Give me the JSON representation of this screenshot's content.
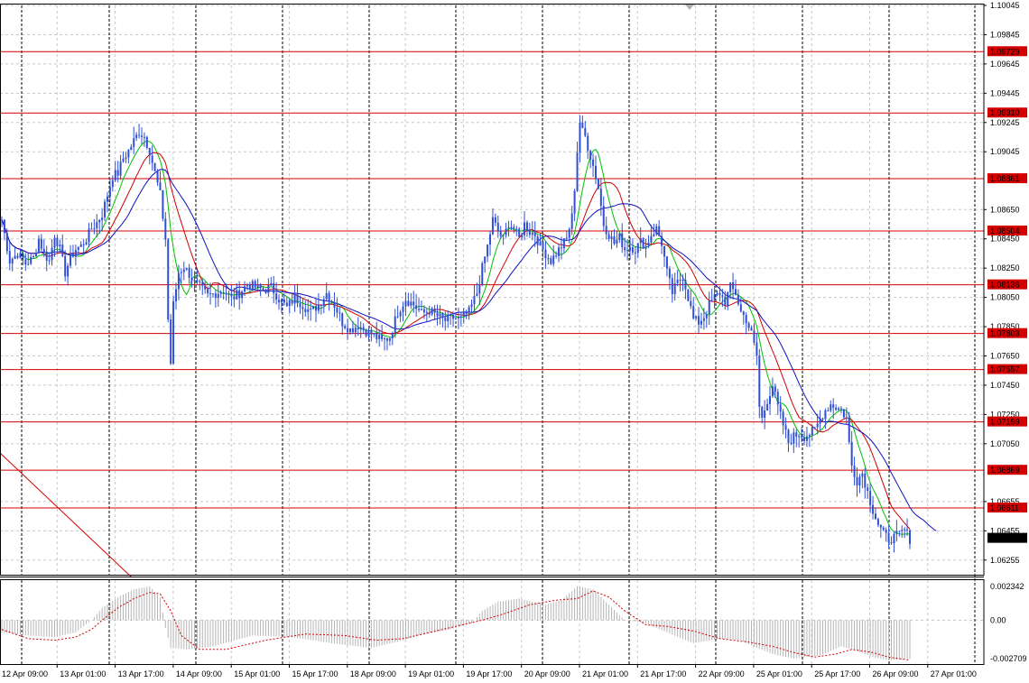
{
  "colors": {
    "background": "#ffffff",
    "grid": "#c8c8c8",
    "candle": "#2f4fd6",
    "level_line": "#d40000",
    "level_badge_bg": "#d40000",
    "level_badge_text": "#ffffff",
    "last_price_bg": "#000000",
    "last_price_text": "#ffffff",
    "ma_fast": "#00c000",
    "ma_mid": "#d00000",
    "ma_slow": "#1010c0",
    "histogram": "#b4b4b4",
    "signal": "#d00000"
  },
  "chart_data": [
    {
      "type": "candlestick",
      "title": "",
      "price_axis": {
        "ylim": [
          1.06155,
          1.10045
        ],
        "tick_labels": [
          "1.10045",
          "1.09845",
          "1.09645",
          "1.09445",
          "1.09245",
          "1.09045",
          "1.08650",
          "1.08450",
          "1.08250",
          "1.08050",
          "1.07850",
          "1.07650",
          "1.07450",
          "1.07250",
          "1.07050",
          "1.06655",
          "1.06455",
          "1.06255"
        ]
      },
      "time_axis": {
        "tick_labels": [
          "12 Apr 09:00",
          "13 Apr 01:00",
          "13 Apr 17:00",
          "14 Apr 09:00",
          "15 Apr 01:00",
          "15 Apr 17:00",
          "18 Apr 09:00",
          "19 Apr 01:00",
          "19 Apr 17:00",
          "20 Apr 09:00",
          "21 Apr 01:00",
          "21 Apr 17:00",
          "22 Apr 09:00",
          "25 Apr 01:00",
          "25 Apr 17:00",
          "26 Apr 09:00",
          "27 Apr 01:00"
        ],
        "period_separators": [
          "13 Apr 01:00",
          "14 Apr 01:00",
          "15 Apr 01:00",
          "18 Apr 01:00",
          "19 Apr 01:00",
          "20 Apr 01:00",
          "21 Apr 01:00",
          "22 Apr 01:00",
          "25 Apr 01:00",
          "26 Apr 01:00",
          "27 Apr 01:00"
        ]
      },
      "horizontal_levels": [
        "1.09729",
        "1.09310",
        "1.08861",
        "1.08504",
        "1.08136",
        "1.07803",
        "1.07557",
        "1.07199",
        "1.06869",
        "1.06611"
      ],
      "last_price": "1.06404",
      "close_path": [
        [
          0,
          1.0858
        ],
        [
          3,
          1.083
        ],
        [
          6,
          1.0835
        ],
        [
          9,
          1.0828
        ],
        [
          12,
          1.0832
        ],
        [
          14,
          1.0845
        ],
        [
          16,
          1.0835
        ],
        [
          18,
          1.083
        ],
        [
          20,
          1.0848
        ],
        [
          22,
          1.0838
        ],
        [
          24,
          1.0822
        ],
        [
          26,
          1.0832
        ],
        [
          28,
          1.0838
        ],
        [
          30,
          1.084
        ],
        [
          32,
          1.0845
        ],
        [
          34,
          1.0852
        ],
        [
          36,
          1.0856
        ],
        [
          38,
          1.0862
        ],
        [
          40,
          1.0875
        ],
        [
          42,
          1.0888
        ],
        [
          44,
          1.089
        ],
        [
          46,
          1.09
        ],
        [
          48,
          1.0905
        ],
        [
          50,
          1.0912
        ],
        [
          52,
          1.0918
        ],
        [
          54,
          1.0915
        ],
        [
          56,
          1.0905
        ],
        [
          58,
          1.089
        ],
        [
          60,
          1.0875
        ],
        [
          62,
          1.0845
        ],
        [
          63,
          1.079
        ],
        [
          64,
          1.076
        ],
        [
          65,
          1.08
        ],
        [
          67,
          1.0822
        ],
        [
          69,
          1.0826
        ],
        [
          71,
          1.0821
        ],
        [
          73,
          1.0815
        ],
        [
          75,
          1.0812
        ],
        [
          78,
          1.0806
        ],
        [
          81,
          1.0808
        ],
        [
          84,
          1.081
        ],
        [
          87,
          1.0804
        ],
        [
          90,
          1.0808
        ],
        [
          93,
          1.0814
        ],
        [
          96,
          1.0812
        ],
        [
          99,
          1.081
        ],
        [
          102,
          1.0812
        ],
        [
          105,
          1.0804
        ],
        [
          108,
          1.0798
        ],
        [
          111,
          1.0805
        ],
        [
          114,
          1.08
        ],
        [
          117,
          1.0795
        ],
        [
          120,
          1.08
        ],
        [
          123,
          1.0808
        ],
        [
          126,
          1.08
        ],
        [
          129,
          1.0788
        ],
        [
          132,
          1.0783
        ],
        [
          135,
          1.0786
        ],
        [
          138,
          1.0782
        ],
        [
          141,
          1.0779
        ],
        [
          144,
          1.0775
        ],
        [
          147,
          1.0778
        ],
        [
          150,
          1.0795
        ],
        [
          153,
          1.0804
        ],
        [
          156,
          1.08
        ],
        [
          159,
          1.0794
        ],
        [
          162,
          1.0796
        ],
        [
          165,
          1.0792
        ],
        [
          168,
          1.0789
        ],
        [
          171,
          1.0791
        ],
        [
          174,
          1.079
        ],
        [
          177,
          1.0795
        ],
        [
          180,
          1.0808
        ],
        [
          182,
          1.0825
        ],
        [
          184,
          1.084
        ],
        [
          186,
          1.0858
        ],
        [
          188,
          1.085
        ],
        [
          190,
          1.0845
        ],
        [
          192,
          1.0856
        ],
        [
          194,
          1.0852
        ],
        [
          196,
          1.0845
        ],
        [
          198,
          1.0855
        ],
        [
          200,
          1.085
        ],
        [
          202,
          1.0848
        ],
        [
          204,
          1.084
        ],
        [
          206,
          1.0835
        ],
        [
          208,
          1.083
        ],
        [
          210,
          1.0835
        ],
        [
          212,
          1.084
        ],
        [
          214,
          1.0845
        ],
        [
          216,
          1.086
        ],
        [
          217,
          1.088
        ],
        [
          218,
          1.0905
        ],
        [
          219,
          1.0925
        ],
        [
          220,
          1.0918
        ],
        [
          221,
          1.0915
        ],
        [
          222,
          1.0908
        ],
        [
          224,
          1.0895
        ],
        [
          226,
          1.088
        ],
        [
          228,
          1.0855
        ],
        [
          230,
          1.0848
        ],
        [
          232,
          1.0842
        ],
        [
          234,
          1.0846
        ],
        [
          236,
          1.0838
        ],
        [
          238,
          1.084
        ],
        [
          240,
          1.0838
        ],
        [
          242,
          1.0843
        ],
        [
          244,
          1.084
        ],
        [
          246,
          1.0848
        ],
        [
          248,
          1.0852
        ],
        [
          250,
          1.0842
        ],
        [
          252,
          1.0822
        ],
        [
          254,
          1.0808
        ],
        [
          256,
          1.0815
        ],
        [
          258,
          1.082
        ],
        [
          260,
          1.0805
        ],
        [
          262,
          1.079
        ],
        [
          264,
          1.0788
        ],
        [
          266,
          1.0792
        ],
        [
          268,
          1.08
        ],
        [
          270,
          1.0805
        ],
        [
          272,
          1.0808
        ],
        [
          274,
          1.0802
        ],
        [
          276,
          1.0812
        ],
        [
          278,
          1.0808
        ],
        [
          280,
          1.0795
        ],
        [
          282,
          1.079
        ],
        [
          284,
          1.078
        ],
        [
          286,
          1.0765
        ],
        [
          287,
          1.073
        ],
        [
          288,
          1.0722
        ],
        [
          290,
          1.0735
        ],
        [
          292,
          1.0745
        ],
        [
          294,
          1.073
        ],
        [
          296,
          1.0718
        ],
        [
          298,
          1.0706
        ],
        [
          300,
          1.071
        ],
        [
          302,
          1.0712
        ],
        [
          304,
          1.071
        ],
        [
          306,
          1.0712
        ],
        [
          308,
          1.0714
        ],
        [
          310,
          1.0722
        ],
        [
          312,
          1.0728
        ],
        [
          314,
          1.0732
        ],
        [
          316,
          1.073
        ],
        [
          318,
          1.0728
        ],
        [
          320,
          1.0722
        ],
        [
          321,
          1.0705
        ],
        [
          322,
          1.069
        ],
        [
          324,
          1.068
        ],
        [
          326,
          1.0685
        ],
        [
          328,
          1.0672
        ],
        [
          330,
          1.066
        ],
        [
          332,
          1.065
        ],
        [
          334,
          1.0643
        ],
        [
          336,
          1.064
        ],
        [
          338,
          1.0641
        ],
        [
          340,
          1.0643
        ],
        [
          342,
          1.0646
        ],
        [
          344,
          1.064
        ]
      ],
      "oscillator": {
        "axis_labels": [
          "0.002342",
          "0.00",
          "-0.002709"
        ],
        "ylim": [
          -0.00285,
          0.0026
        ],
        "histogram_path": [
          [
            0,
            -0.0008
          ],
          [
            10,
            -0.001
          ],
          [
            20,
            -0.0011
          ],
          [
            28,
            -0.0008
          ],
          [
            34,
            0.0
          ],
          [
            38,
            0.0008
          ],
          [
            44,
            0.0015
          ],
          [
            50,
            0.002
          ],
          [
            56,
            0.0022
          ],
          [
            60,
            0.0015
          ],
          [
            62,
            -0.0005
          ],
          [
            64,
            -0.0018
          ],
          [
            70,
            -0.0019
          ],
          [
            80,
            -0.0017
          ],
          [
            95,
            -0.001
          ],
          [
            110,
            -0.0011
          ],
          [
            125,
            -0.0015
          ],
          [
            140,
            -0.0018
          ],
          [
            150,
            -0.0014
          ],
          [
            160,
            -0.0009
          ],
          [
            170,
            -0.0006
          ],
          [
            178,
            -0.0002
          ],
          [
            182,
            0.0006
          ],
          [
            188,
            0.0012
          ],
          [
            196,
            0.0014
          ],
          [
            206,
            0.001
          ],
          [
            212,
            0.0013
          ],
          [
            218,
            0.0022
          ],
          [
            224,
            0.002
          ],
          [
            230,
            0.001
          ],
          [
            236,
            0.0
          ],
          [
            244,
            -0.0002
          ],
          [
            252,
            -0.0008
          ],
          [
            262,
            -0.0015
          ],
          [
            272,
            -0.0012
          ],
          [
            280,
            -0.0013
          ],
          [
            286,
            -0.0018
          ],
          [
            292,
            -0.0022
          ],
          [
            300,
            -0.0025
          ],
          [
            310,
            -0.0023
          ],
          [
            318,
            -0.0017
          ],
          [
            324,
            -0.002
          ],
          [
            330,
            -0.0024
          ],
          [
            336,
            -0.0026
          ],
          [
            344,
            -0.0025
          ]
        ],
        "signal_path": [
          [
            0,
            -0.0006
          ],
          [
            10,
            -0.0012
          ],
          [
            20,
            -0.0013
          ],
          [
            28,
            -0.0011
          ],
          [
            34,
            -0.0006
          ],
          [
            38,
            0.0
          ],
          [
            44,
            0.0008
          ],
          [
            50,
            0.0014
          ],
          [
            56,
            0.0018
          ],
          [
            60,
            0.0017
          ],
          [
            64,
            0.0006
          ],
          [
            68,
            -0.001
          ],
          [
            75,
            -0.0019
          ],
          [
            85,
            -0.0019
          ],
          [
            100,
            -0.0013
          ],
          [
            115,
            -0.0009
          ],
          [
            130,
            -0.001
          ],
          [
            142,
            -0.0013
          ],
          [
            152,
            -0.0012
          ],
          [
            162,
            -0.0008
          ],
          [
            172,
            -0.0004
          ],
          [
            182,
            0.0
          ],
          [
            190,
            0.0004
          ],
          [
            200,
            0.001
          ],
          [
            210,
            0.0013
          ],
          [
            218,
            0.0014
          ],
          [
            224,
            0.0019
          ],
          [
            230,
            0.0015
          ],
          [
            236,
            0.0006
          ],
          [
            244,
            -0.0003
          ],
          [
            252,
            -0.0004
          ],
          [
            262,
            -0.0007
          ],
          [
            272,
            -0.0012
          ],
          [
            282,
            -0.0014
          ],
          [
            292,
            -0.0017
          ],
          [
            300,
            -0.0021
          ],
          [
            308,
            -0.0024
          ],
          [
            316,
            -0.0022
          ],
          [
            322,
            -0.0019
          ],
          [
            330,
            -0.0021
          ],
          [
            336,
            -0.0024
          ],
          [
            344,
            -0.0026
          ]
        ]
      }
    }
  ]
}
